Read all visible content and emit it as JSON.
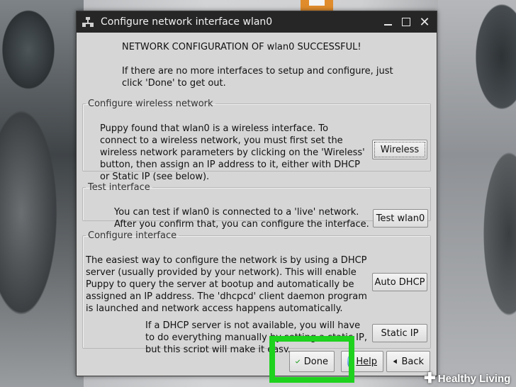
{
  "window": {
    "title": "Configure network interface wlan0"
  },
  "main": {
    "success_text": "NETWORK CONFIGURATION OF wlan0 SUCCESSFUL!",
    "instructions": "If there are no more interfaces to setup and configure, just click 'Done' to get out."
  },
  "wireless_section": {
    "legend": "Configure wireless network",
    "text": "Puppy found that wlan0 is a wireless interface. To connect to a wireless network, you must first set the wireless network parameters by clicking on the 'Wireless' button, then assign an IP address to it, either with DHCP or Static IP (see below).",
    "button_label": "Wireless"
  },
  "test_section": {
    "legend": "Test interface",
    "text": "You can test if wlan0 is connected to a 'live' network. After you confirm that, you can configure the interface.",
    "button_label": "Test wlan0"
  },
  "configure_section": {
    "legend": "Configure interface",
    "dhcp_text": "The easiest way to configure the network is by using a DHCP server (usually provided by your network). This will enable Puppy to query the server at bootup and automatically be assigned an IP address. The 'dhcpcd' client daemon program is launched and network access happens automatically.",
    "dhcp_button_label": "Auto DHCP",
    "static_text": "If a DHCP server is not available, you will have to do everything manually by setting a static IP, but this script will make it easy.",
    "static_button_label": "Static IP"
  },
  "buttons": {
    "done_label": "Done",
    "help_label": "Help",
    "back_label": "Back"
  },
  "watermark": {
    "text": "Healthy Living"
  },
  "colors": {
    "highlight": "#1ed21e",
    "titlebar": "#262626",
    "window_bg": "#d6d6d6"
  }
}
